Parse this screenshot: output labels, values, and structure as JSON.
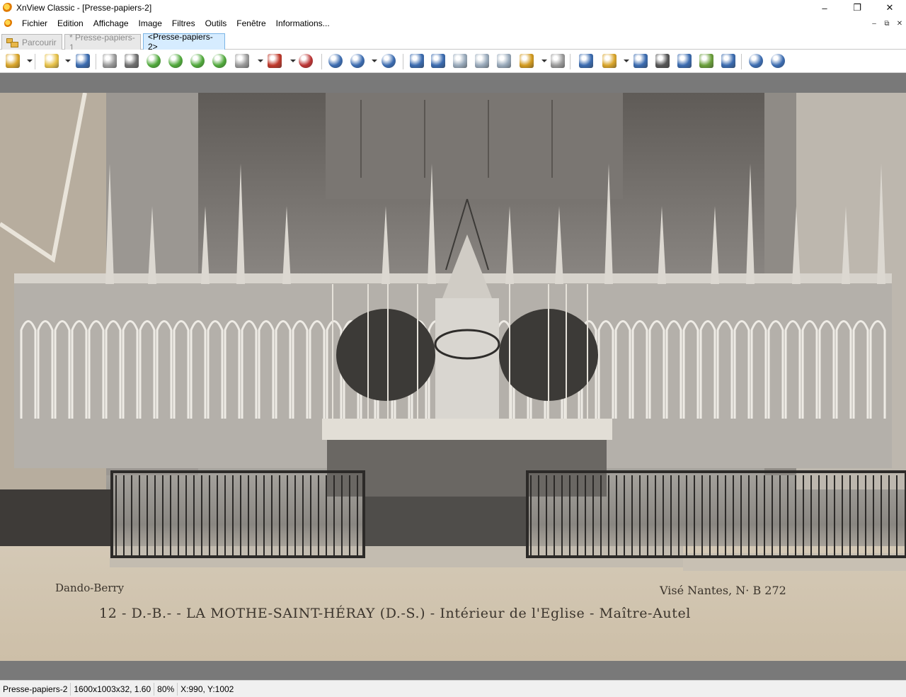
{
  "window": {
    "title": "XnView Classic - [Presse-papiers-2]",
    "controls": [
      "–",
      "❐",
      "✕"
    ]
  },
  "menu": {
    "items": [
      "Fichier",
      "Edition",
      "Affichage",
      "Image",
      "Filtres",
      "Outils",
      "Fenêtre",
      "Informations..."
    ],
    "mdi_controls": [
      "–",
      "⧉",
      "✕"
    ]
  },
  "tabs": [
    {
      "label": "Parcourir",
      "active": false
    },
    {
      "label": "* Presse-papiers-1",
      "active": false
    },
    {
      "label": "<Presse-papiers-2>",
      "active": true
    }
  ],
  "toolbar": {
    "buttons": [
      {
        "icon": "folder-tree-icon",
        "color": "#d9a52a"
      },
      {
        "icon": "open-folder-icon",
        "color": "#e7c24a"
      },
      {
        "icon": "save-disk-icon",
        "color": "#3a6bb0"
      },
      {
        "icon": "undo-icon",
        "color": "#9a9a9a"
      },
      {
        "icon": "crop-icon",
        "color": "#707070"
      },
      {
        "icon": "rotate-left-icon",
        "color": "#4fa83a"
      },
      {
        "icon": "rotate-right-icon",
        "color": "#4fa83a"
      },
      {
        "icon": "export-icon",
        "color": "#4fa83a"
      },
      {
        "icon": "send-icon",
        "color": "#4fa83a"
      },
      {
        "icon": "resize-icon",
        "color": "#9a9a9a"
      },
      {
        "icon": "adjust-colors-icon",
        "color": "#c0392b"
      },
      {
        "icon": "effects-icon",
        "color": "#b33"
      },
      {
        "icon": "zoom-in-icon",
        "color": "#3a6bb0"
      },
      {
        "icon": "zoom-fit-icon",
        "color": "#3a6bb0"
      },
      {
        "icon": "zoom-out-icon",
        "color": "#3a6bb0"
      },
      {
        "icon": "previous-icon",
        "color": "#3a6bb0"
      },
      {
        "icon": "next-icon",
        "color": "#3a6bb0"
      },
      {
        "icon": "first-page-icon",
        "color": "#9ab"
      },
      {
        "icon": "next-page-icon",
        "color": "#9ab"
      },
      {
        "icon": "multi-page-icon",
        "color": "#9ab"
      },
      {
        "icon": "slideshow-icon",
        "color": "#d39b1f"
      },
      {
        "icon": "compare-icon",
        "color": "#9a9a9a"
      },
      {
        "icon": "fullscreen-icon",
        "color": "#3a6bb0"
      },
      {
        "icon": "share-icon",
        "color": "#d9a52a"
      },
      {
        "icon": "find-icon",
        "color": "#3a6bb0"
      },
      {
        "icon": "print-icon",
        "color": "#555"
      },
      {
        "icon": "scan-icon",
        "color": "#3a6bb0"
      },
      {
        "icon": "slides-icon",
        "color": "#6a9f3a"
      },
      {
        "icon": "camera-icon",
        "color": "#3a6bb0"
      },
      {
        "icon": "settings-icon",
        "color": "#3a6bb0"
      },
      {
        "icon": "info-icon",
        "color": "#3a6bb0"
      }
    ]
  },
  "photo": {
    "caption_left": "Dando-Berry",
    "caption_right": "Visé Nantes, N· B 272",
    "caption_main": "12 - D.-B.- - LA MOTHE-SAINT-HÉRAY (D.-S.) - Intérieur de l'Eglise - Maître-Autel"
  },
  "status": {
    "name": "Presse-papiers-2",
    "info": "1600x1003x32, 1.60",
    "zoom": "80%",
    "coords": "X:990, Y:1002"
  }
}
